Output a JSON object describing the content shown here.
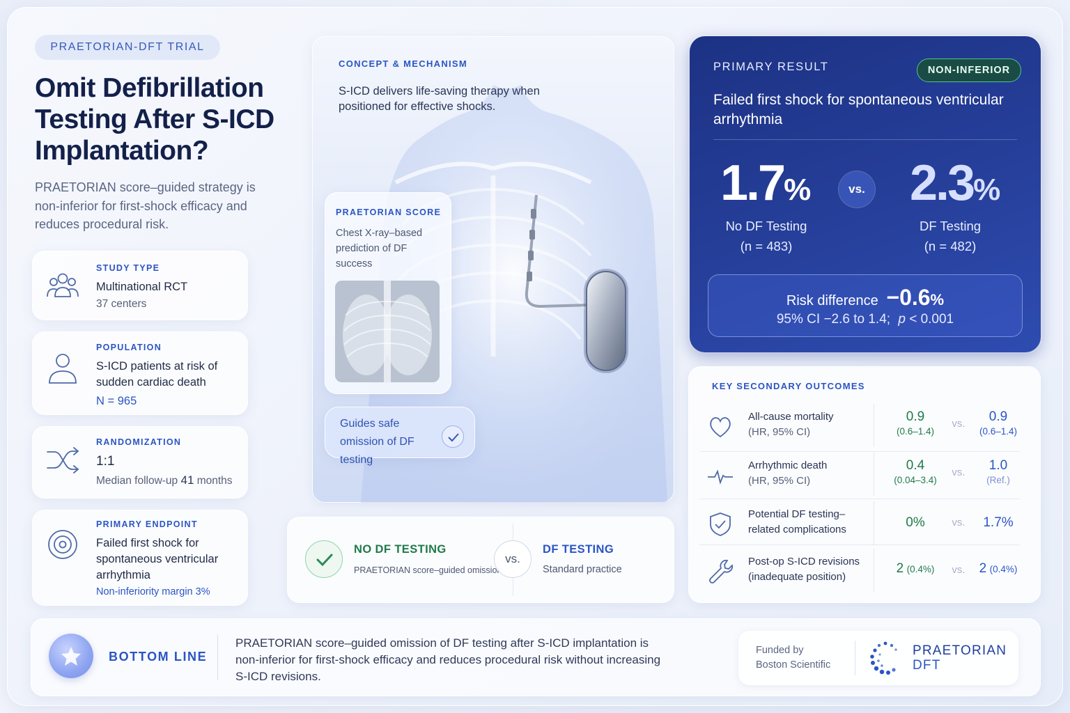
{
  "header": {
    "trial_pill": "PRAETORIAN-DFT TRIAL",
    "title": "Omit Defibrillation Testing After S-ICD Implantation?",
    "subtitle": "PRAETORIAN score–guided strategy is non-inferior for first-shock efficacy and reduces procedural risk."
  },
  "info_cards": [
    {
      "eyebrow": "STUDY TYPE",
      "main": "Multinational RCT",
      "sub": "37 centers",
      "icon": "people-group-icon"
    },
    {
      "eyebrow": "POPULATION",
      "main": "S-ICD patients at risk of sudden cardiac death",
      "blue": "N = 965",
      "icon": "person-icon"
    },
    {
      "eyebrow": "RANDOMIZATION",
      "main": "1:1",
      "sub_prefix": "Median follow-up ",
      "sub_value": "41",
      "sub_suffix": " months",
      "icon": "shuffle-icon"
    },
    {
      "eyebrow": "PRIMARY ENDPOINT",
      "main": "Failed first shock for spontaneous ventricular arrhythmia",
      "blue": "Non-inferiority margin 3%",
      "icon": "target-icon"
    }
  ],
  "concept": {
    "eyebrow": "CONCEPT & MECHANISM",
    "description": "S-ICD delivers life-saving therapy when positioned for effective shocks.",
    "score_eyebrow": "PRAETORIAN SCORE",
    "score_description": "Chest X-ray–based prediction of DF success",
    "guides": "Guides safe omission of DF testing"
  },
  "compare": {
    "left_title": "NO DF TESTING",
    "left_sub": "PRAETORIAN score–guided omission",
    "vs": "vs.",
    "right_title": "DF TESTING",
    "right_sub": "Standard practice"
  },
  "primary": {
    "eyebrow": "PRIMARY RESULT",
    "badge": "NON-INFERIOR",
    "outcome": "Failed first shock for spontaneous ventricular arrhythmia",
    "left_value": "1.7",
    "left_label": "No DF Testing",
    "left_n": "(n = 483)",
    "vs": "vs.",
    "right_value": "2.3",
    "right_label": "DF Testing",
    "right_n": "(n = 482)",
    "pct": "%",
    "risk_label": "Risk difference",
    "risk_value": "−0.6",
    "ci_text": "95% CI  −2.6 to 1.4;",
    "p_label": "p",
    "p_value": "< 0.001"
  },
  "secondary": {
    "eyebrow": "KEY SECONDARY OUTCOMES",
    "vs": "vs.",
    "rows": [
      {
        "label": "All-cause mortality",
        "sub": "(HR, 95% CI)",
        "a": "0.9",
        "a_sub": "(0.6–1.4)",
        "b": "0.9",
        "b_sub": "(0.6–1.4)",
        "icon": "heart-icon"
      },
      {
        "label": "Arrhythmic death",
        "sub": "(HR, 95% CI)",
        "a": "0.4",
        "a_sub": "(0.04–3.4)",
        "b": "1.0",
        "b_sub": "(Ref.)",
        "icon": "pulse-icon"
      },
      {
        "label": "Potential DF testing–",
        "sub": "related complications",
        "a": "0%",
        "a_sub": "",
        "b": "1.7%",
        "b_sub": "",
        "icon": "shield-icon"
      },
      {
        "label": "Post-op S-ICD revisions",
        "sub": "(inadequate position)",
        "a": "2",
        "a_sub": "(0.4%)",
        "b": "2",
        "b_sub": "(0.4%)",
        "icon": "wrench-icon"
      }
    ]
  },
  "bottom": {
    "label": "BOTTOM LINE",
    "text": "PRAETORIAN score–guided omission of DF testing after S-ICD implantation is non-inferior for first-shock efficacy and reduces procedural risk without increasing S-ICD revisions.",
    "funded_line1": "Funded by",
    "funded_line2": "Boston Scientific",
    "logo_line1": "PRAETORIAN",
    "logo_line2": "DFT"
  },
  "colors": {
    "accent": "#2a55c4",
    "primary_panel": "#22398f",
    "success": "#1f7a4a",
    "badge_border": "#4fc58f"
  }
}
